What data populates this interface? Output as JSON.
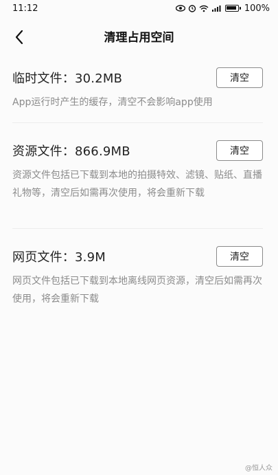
{
  "status_bar": {
    "time": "11:12",
    "battery": "100%",
    "battery_level": 100,
    "icons": [
      "eye-icon",
      "alarm-icon",
      "wifi-icon",
      "signal-icon",
      "battery-icon"
    ]
  },
  "nav": {
    "title": "清理占用空间",
    "back_icon": "chevron-left-icon"
  },
  "sections": [
    {
      "title": "临时文件：30.2MB",
      "button": "清空",
      "description": "App运行时产生的缓存，清空不会影响app使用"
    },
    {
      "title": "资源文件：866.9MB",
      "button": "清空",
      "description": "资源文件包括已下载到本地的拍摄特效、滤镜、贴纸、直播礼物等，清空后如需再次使用，将会重新下载"
    },
    {
      "title": "网页文件：3.9M",
      "button": "清空",
      "description": "网页文件包括已下载到本地离线网页资源，清空后如需再次使用，将会重新下载"
    }
  ],
  "watermark": "@恒人众"
}
